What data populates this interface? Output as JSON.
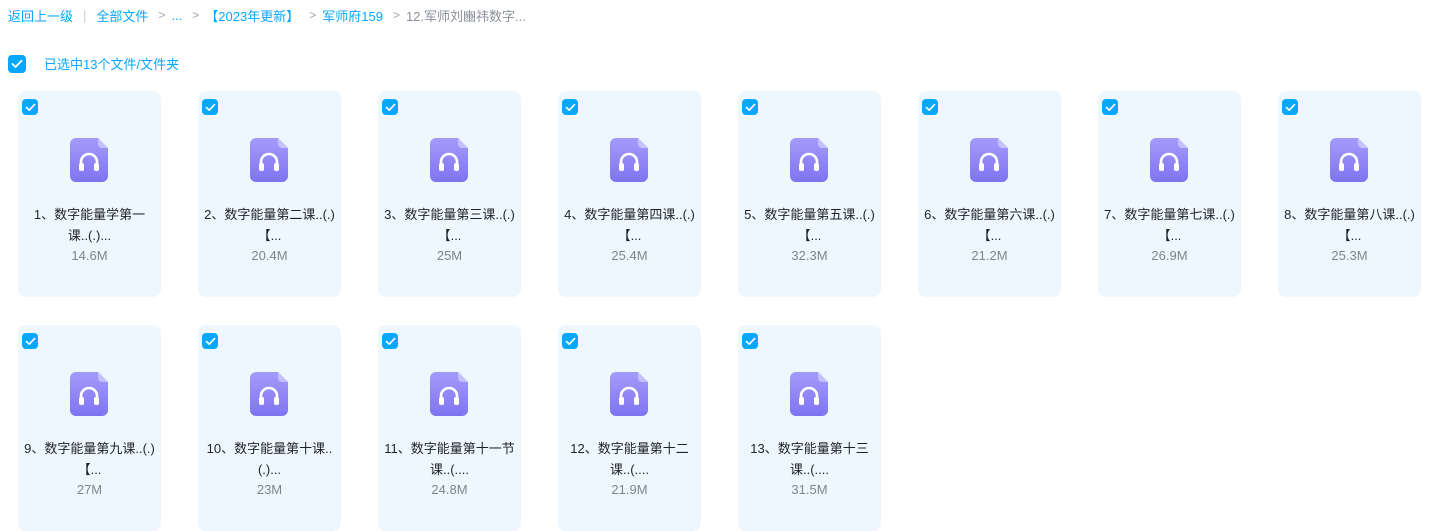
{
  "breadcrumb": {
    "back": "返回上一级",
    "root": "全部文件",
    "ellipsis": "...",
    "folder1": "【2023年更新】",
    "folder2": "军师府159",
    "current": "12.军师刘豳祎数字..."
  },
  "selection": {
    "label": "已选中13个文件/文件夹",
    "checked": true
  },
  "files": [
    {
      "name": "1、数字能量学第一课..(.)...",
      "size": "14.6M"
    },
    {
      "name": "2、数字能量第二课..(.)【...",
      "size": "20.4M"
    },
    {
      "name": "3、数字能量第三课..(.)【...",
      "size": "25M"
    },
    {
      "name": "4、数字能量第四课..(.)【...",
      "size": "25.4M"
    },
    {
      "name": "5、数字能量第五课..(.)【...",
      "size": "32.3M"
    },
    {
      "name": "6、数字能量第六课..(.)【...",
      "size": "21.2M"
    },
    {
      "name": "7、数字能量第七课..(.)【...",
      "size": "26.9M"
    },
    {
      "name": "8、数字能量第八课..(.)【...",
      "size": "25.3M"
    },
    {
      "name": "9、数字能量第九课..(.)【...",
      "size": "27M"
    },
    {
      "name": "10、数字能量第十课..(.)...",
      "size": "23M"
    },
    {
      "name": "11、数字能量第十一节课..(....",
      "size": "24.8M"
    },
    {
      "name": "12、数字能量第十二课..(....",
      "size": "21.9M"
    },
    {
      "name": "13、数字能量第十三课..(....",
      "size": "31.5M"
    }
  ],
  "icons": {
    "file": "audio-file-icon",
    "check": "checkmark-icon"
  },
  "colors": {
    "accent": "#06a7ff",
    "card_bg": "#eef7fd",
    "file_icon": "#8d83f7"
  }
}
